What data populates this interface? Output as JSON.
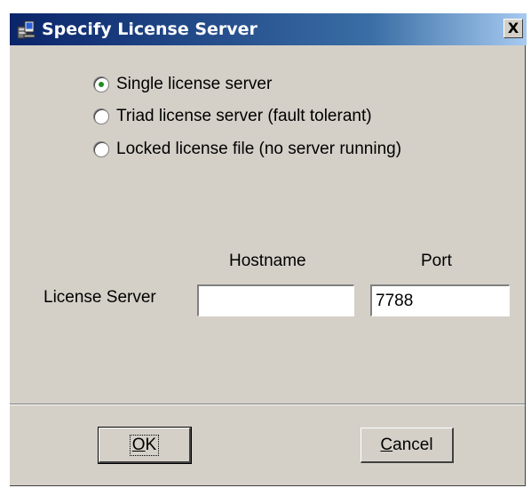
{
  "window": {
    "title": "Specify License Server",
    "close_symbol": "X",
    "icon": "license-server-icon"
  },
  "options": [
    {
      "label": "Single license server",
      "checked": true
    },
    {
      "label": "Triad license server (fault tolerant)",
      "checked": false
    },
    {
      "label": "Locked license file (no server running)",
      "checked": false
    }
  ],
  "columns": {
    "hostname": "Hostname",
    "port": "Port"
  },
  "license_server": {
    "label": "License Server",
    "hostname_value": "",
    "port_value": "7788"
  },
  "buttons": {
    "ok_mnemonic": "O",
    "ok_rest": "K",
    "cancel_mnemonic": "C",
    "cancel_rest": "ancel"
  },
  "colors": {
    "title_bar_start": "#0a246a",
    "title_bar_end": "#a6caf0",
    "dialog_face": "#d4d0c8",
    "radio_dot": "#1f8f1f"
  }
}
